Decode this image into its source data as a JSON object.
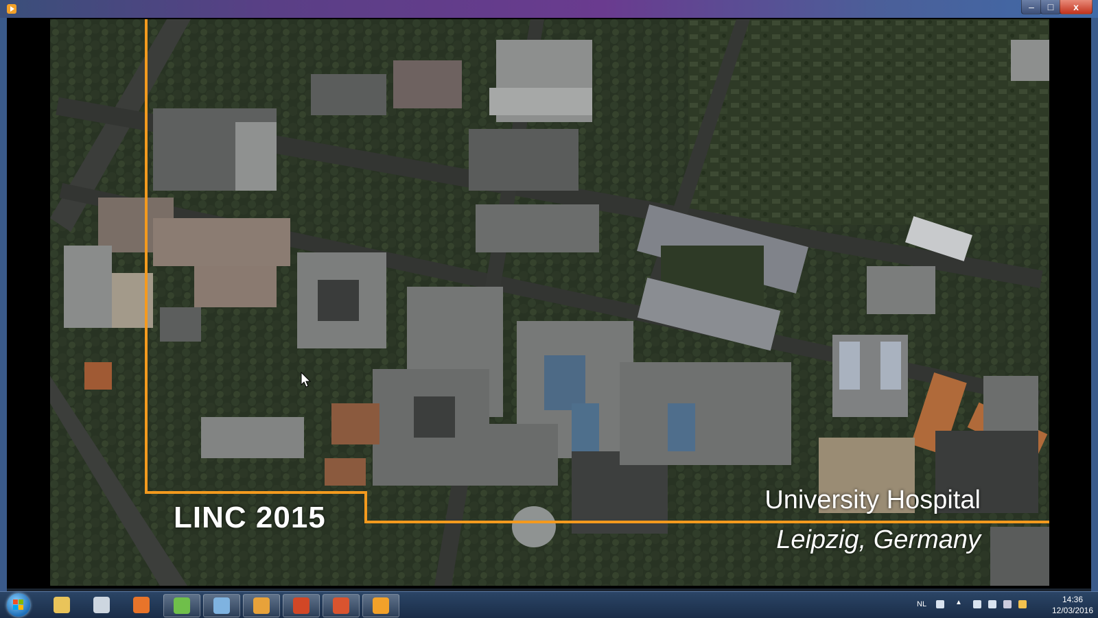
{
  "window": {
    "title": "",
    "minimize_label": "–",
    "maximize_label": "□",
    "close_label": "x"
  },
  "slide": {
    "title": "LINC 2015",
    "location_line1": "University Hospital",
    "location_line2": "Leipzig, Germany",
    "accent_color": "#f39a1e"
  },
  "taskbar": {
    "apps": [
      {
        "name": "explorer-icon",
        "color": "#e9c45a"
      },
      {
        "name": "calculator-icon",
        "color": "#cdd6e0"
      },
      {
        "name": "firefox-icon",
        "color": "#e8742a"
      },
      {
        "name": "archive-icon",
        "color": "#6fbf4a"
      },
      {
        "name": "image-viewer-icon",
        "color": "#7fb3e0"
      },
      {
        "name": "paint-icon",
        "color": "#e8a23a"
      },
      {
        "name": "powerpoint-icon",
        "color": "#d24726"
      },
      {
        "name": "presenter-icon",
        "color": "#d9542f"
      },
      {
        "name": "media-player-icon",
        "color": "#f2a12a"
      }
    ],
    "language": "NL",
    "time": "14:36",
    "date": "12/03/2016"
  }
}
